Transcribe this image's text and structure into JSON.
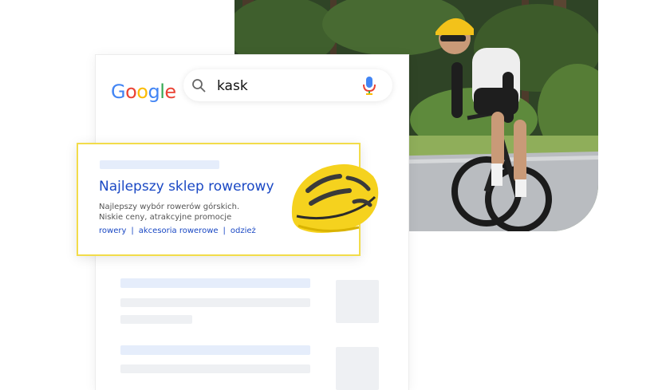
{
  "search": {
    "brand": "Google",
    "query": "kask"
  },
  "ad": {
    "headline": "Najlepszy sklep rowerowy",
    "description_line1": "Najlepszy wybór rowerów górskich.",
    "description_line2": "Niskie ceny, atrakcyjne promocje",
    "sitelinks": [
      "rowery",
      "akcesoria rowerowe",
      "odzież"
    ]
  },
  "colors": {
    "link_blue": "#1a48c4",
    "ad_border": "#f2dc4a",
    "helmet_yellow": "#f5d21e",
    "google_blue": "#4285f4",
    "google_red": "#ea4335",
    "google_yellow": "#fbbc05",
    "google_green": "#34a853"
  },
  "icons": [
    "search-icon",
    "microphone-icon",
    "helmet-image",
    "cyclist-photo"
  ]
}
